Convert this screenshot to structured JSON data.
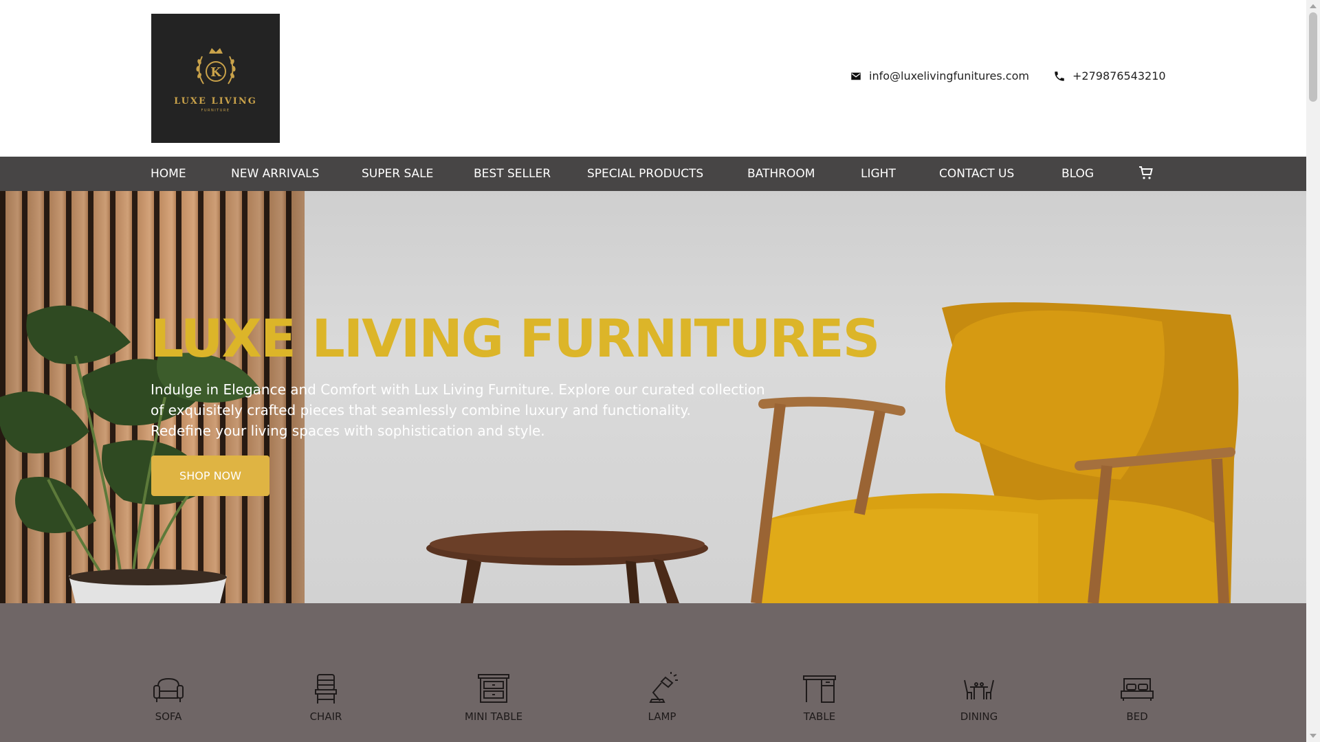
{
  "brand": {
    "logo_name": "LUXE LIVING",
    "logo_sub": "FURNITURE",
    "logo_letter": "K",
    "background_color": "#232323",
    "gold_color": "#c9a24a"
  },
  "header": {
    "email": "info@luxelivingfunitures.com",
    "phone": "+279876543210",
    "email_icon": "mail-icon",
    "phone_icon": "phone-icon"
  },
  "nav": {
    "items": [
      {
        "label": "HOME"
      },
      {
        "label": "NEW ARRIVALS"
      },
      {
        "label": "SUPER SALE"
      },
      {
        "label": "BEST SELLER"
      },
      {
        "label": "SPECIAL PRODUCTS"
      },
      {
        "label": "BATHROOM"
      },
      {
        "label": "LIGHT"
      },
      {
        "label": "CONTACT US"
      },
      {
        "label": "BLOG"
      }
    ],
    "cart_icon": "cart-icon",
    "background_color": "#474545"
  },
  "hero": {
    "title": "LUXE LIVING FURNITURES",
    "description_lines": [
      "Indulge in Elegance and Comfort with Lux Living Furniture. Explore our curated collection",
      "of exquisitely crafted pieces that seamlessly combine luxury and functionality.",
      "Redefine your living spaces with sophistication and style."
    ],
    "button_label": "SHOP NOW",
    "title_color": "#dcb529",
    "button_color": "#dfb443"
  },
  "categories": {
    "background_color": "#6f6666",
    "items": [
      {
        "label": "SOFA",
        "icon": "sofa-icon"
      },
      {
        "label": "CHAIR",
        "icon": "chair-icon"
      },
      {
        "label": "MINI TABLE",
        "icon": "mini-table-icon"
      },
      {
        "label": "LAMP",
        "icon": "lamp-icon"
      },
      {
        "label": "TABLE",
        "icon": "table-icon"
      },
      {
        "label": "DINING",
        "icon": "dining-icon"
      },
      {
        "label": "BED",
        "icon": "bed-icon"
      }
    ]
  }
}
